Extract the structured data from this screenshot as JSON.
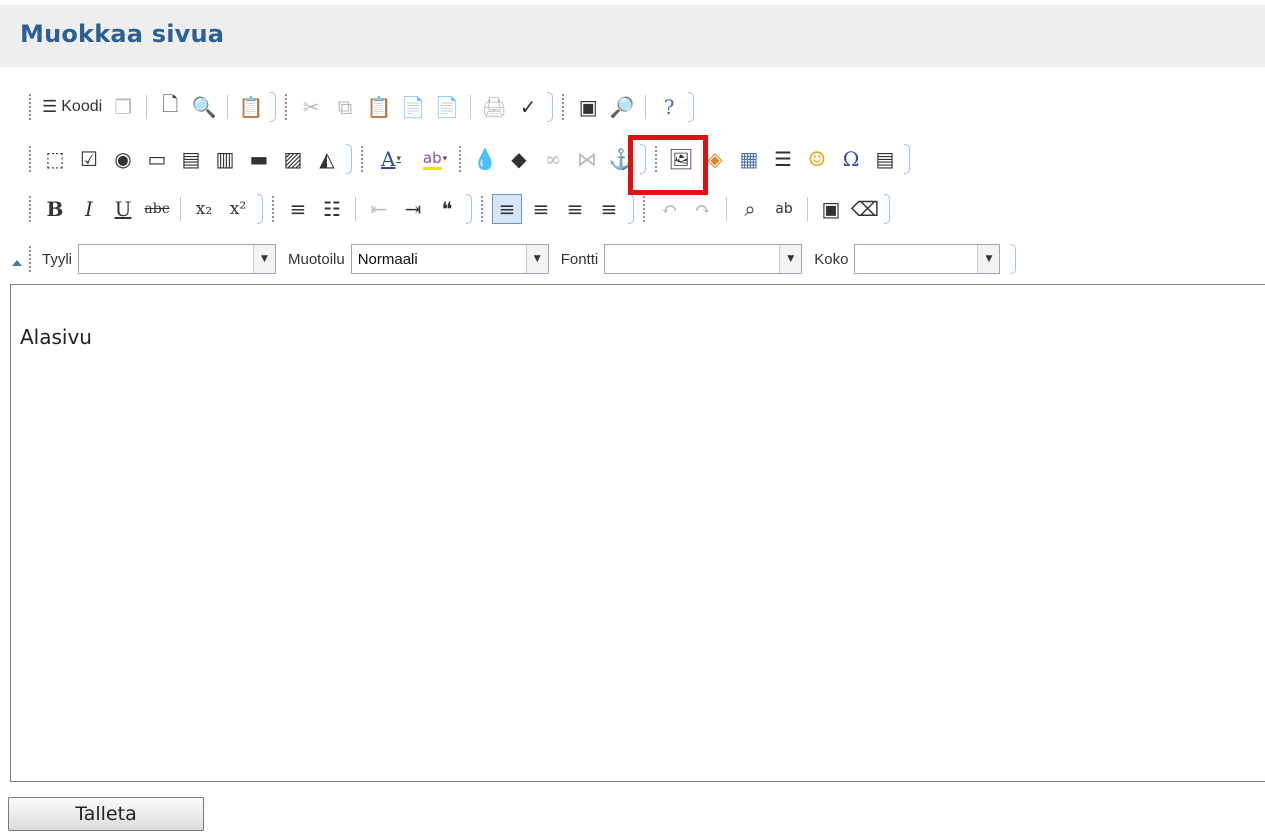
{
  "header": {
    "title": "Muokkaa sivua"
  },
  "toolbar": {
    "source_label": "Koodi",
    "styles_label": "Tyyli",
    "styles_value": "",
    "format_label": "Muotoilu",
    "format_value": "Normaali",
    "font_label": "Fontti",
    "font_value": "",
    "size_label": "Koko",
    "size_value": ""
  },
  "icons": {
    "source": "☰",
    "templates": "❐",
    "new_page": "🗋",
    "preview": "🔍",
    "paste_word": "📋",
    "cut": "✂",
    "copy": "⧉",
    "paste": "📋",
    "paste_text": "📄",
    "paste_from": "📄",
    "print": "🖨",
    "spellcheck": "✓",
    "maximize": "▣",
    "show_blocks": "🔎",
    "about": "?",
    "form": "⬚",
    "checkbox": "☑",
    "radio": "◉",
    "textfield": "▭",
    "select": "▤",
    "textarea": "▥",
    "button": "▬",
    "imagebutton": "▨",
    "hiddenfield": "◭",
    "text_color": "A",
    "bg_color": "ab",
    "iframe_drop": "💧",
    "flash": "◆",
    "link": "∞",
    "unlink": "⋈",
    "anchor": "⚓",
    "image": "🖼",
    "object": "◈",
    "table": "▦",
    "hr": "☰",
    "smiley": "☺",
    "special_char": "Ω",
    "pagebreak": "▤",
    "bold": "B",
    "italic": "I",
    "underline": "U",
    "strike": "abc",
    "subscript": "x₂",
    "superscript": "x²",
    "ordered_list": "≡",
    "bullet_list": "☷",
    "outdent": "⇤",
    "indent": "⇥",
    "blockquote": "❝",
    "align_left": "≡",
    "align_center": "≡",
    "align_right": "≡",
    "justify": "≡",
    "undo": "↶",
    "redo": "↷",
    "find": "⌕",
    "replace": "ab",
    "select_all": "▣",
    "remove_format": "⌫"
  },
  "content": {
    "text": "Alasivu"
  },
  "actions": {
    "save_label": "Talleta"
  },
  "colors": {
    "title": "#2d6092",
    "highlight_border": "#e01010",
    "active_button": "#d7e6f7"
  }
}
